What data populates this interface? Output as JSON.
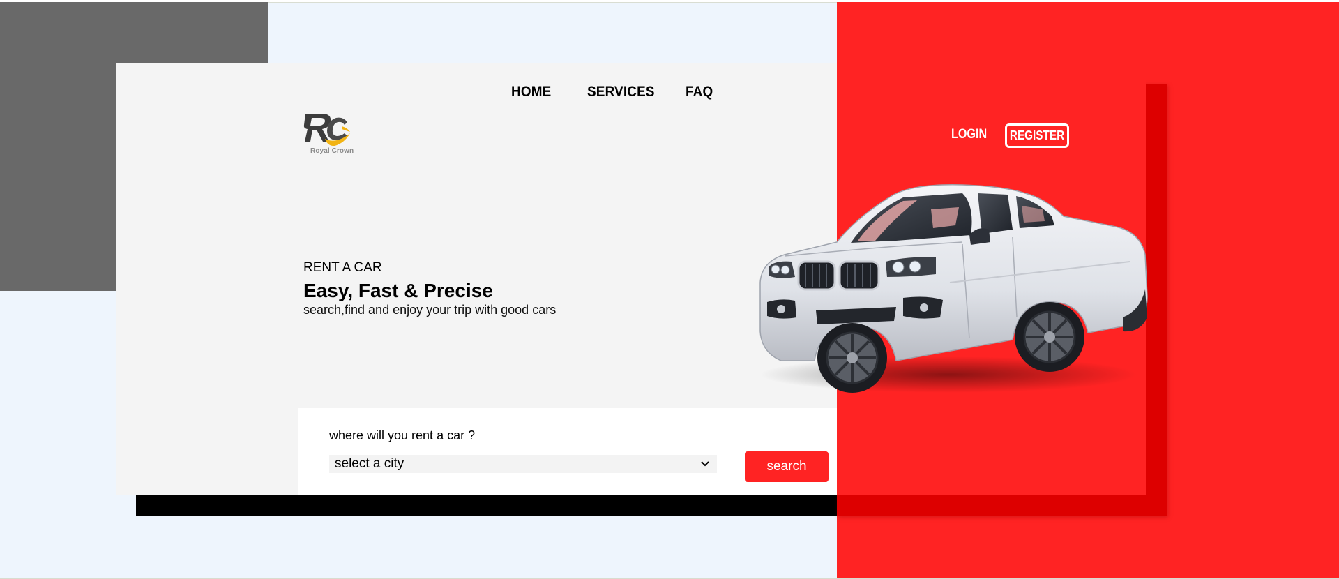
{
  "nav": {
    "items": [
      {
        "label": "HOME"
      },
      {
        "label": "SERVICES"
      },
      {
        "label": "FAQ"
      }
    ]
  },
  "brand": {
    "logo_icon": "rc-monogram-logo",
    "name": "Royal Crown"
  },
  "auth": {
    "login_label": "LOGIN",
    "register_label": "REGISTER"
  },
  "hero": {
    "kicker": "RENT A CAR",
    "title": "Easy, Fast & Precise",
    "subtitle": "search,find and enjoy your trip with good cars",
    "image": "white-suv-car"
  },
  "search": {
    "label": "where will you rent a car ?",
    "select_value": "select a city",
    "button_label": "search"
  },
  "colors": {
    "accent_red": "#ff2323",
    "dark_red": "#dd0000",
    "gray_block": "#696969",
    "card_bg": "#f4f4f4",
    "page_bg": "#eef5fd"
  }
}
